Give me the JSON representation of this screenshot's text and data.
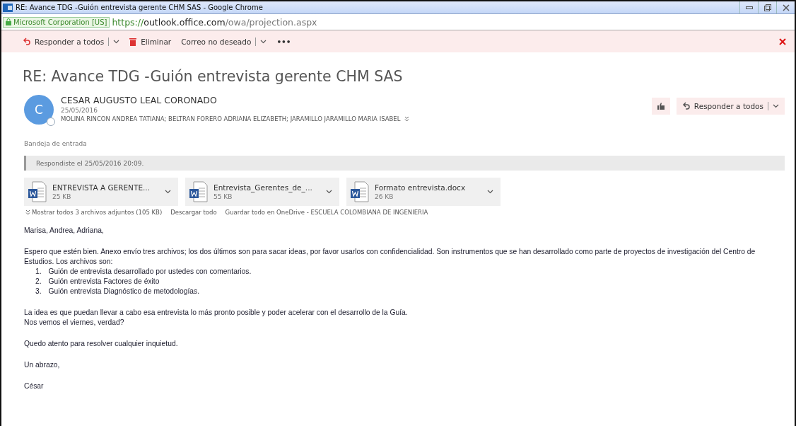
{
  "window": {
    "title": "RE: Avance TDG -Guión entrevista gerente CHM SAS - Google Chrome"
  },
  "address_bar": {
    "certificate": "Microsoft Corporation [US]",
    "scheme": "https://",
    "host": "outlook.office.com",
    "path": "/owa/projection.aspx"
  },
  "toolbar": {
    "reply_all": "Responder a todos",
    "delete": "Eliminar",
    "junk": "Correo no deseado",
    "more": "•••"
  },
  "message": {
    "subject": "RE: Avance TDG -Guión entrevista gerente CHM SAS",
    "avatar_initial": "C",
    "sender": "CESAR AUGUSTO LEAL CORONADO",
    "date": "25/05/2016",
    "recipients": "MOLINA RINCON ANDREA TATIANA; BELTRAN FORERO ADRIANA ELIZABETH; JARAMILLO JARAMILLO MARIA ISABEL",
    "reply_all": "Responder a todos",
    "folder": "Bandeja de entrada",
    "info_bar": "Respondiste el 25/05/2016 20:09.",
    "attachments": [
      {
        "name": "ENTREVISTA A GERENTE...",
        "size": "25 KB"
      },
      {
        "name": "Entrevista_Gerentes_de_...",
        "size": "55 KB"
      },
      {
        "name": "Formato entrevista.docx",
        "size": "26 KB"
      }
    ],
    "attachment_actions": {
      "show_all": "Mostrar todos 3 archivos adjuntos (105 KB)",
      "download": "Descargar todo",
      "save": "Guardar todo en OneDrive - ESCUELA COLOMBIANA DE INGENIERIA"
    },
    "body": [
      {
        "kind": "para",
        "text": "Marisa, Andrea, Adriana,"
      },
      {
        "kind": "para",
        "text": "Espero que estén bien. Anexo envío tres  archivos; los dos últimos son para sacar ideas, por favor usarlos con confidencialidad. Son instrumentos que se han desarrollado como parte de proyectos de investigación del Centro de Estudios. Los archivos son:",
        "items": [
          {
            "number": "1.",
            "text": "Guión de entrevista desarrollado por ustedes con comentarios."
          },
          {
            "number": "2.",
            "text": "Guión entrevista Factores de éxito"
          },
          {
            "number": "3.",
            "text": "Guión entrevista Diagnóstico de metodologías."
          }
        ]
      },
      {
        "kind": "lines",
        "lines": [
          "La idea es que puedan llevar a cabo esa entrevista lo más pronto posible y poder acelerar con el desarrollo de la Guía.",
          "Nos vemos el viernes, verdad?"
        ]
      },
      {
        "kind": "para",
        "text": "Quedo atento para resolver cualquier inquietud."
      },
      {
        "kind": "para",
        "text": "Un abrazo,"
      },
      {
        "kind": "para",
        "text": "César"
      }
    ]
  }
}
